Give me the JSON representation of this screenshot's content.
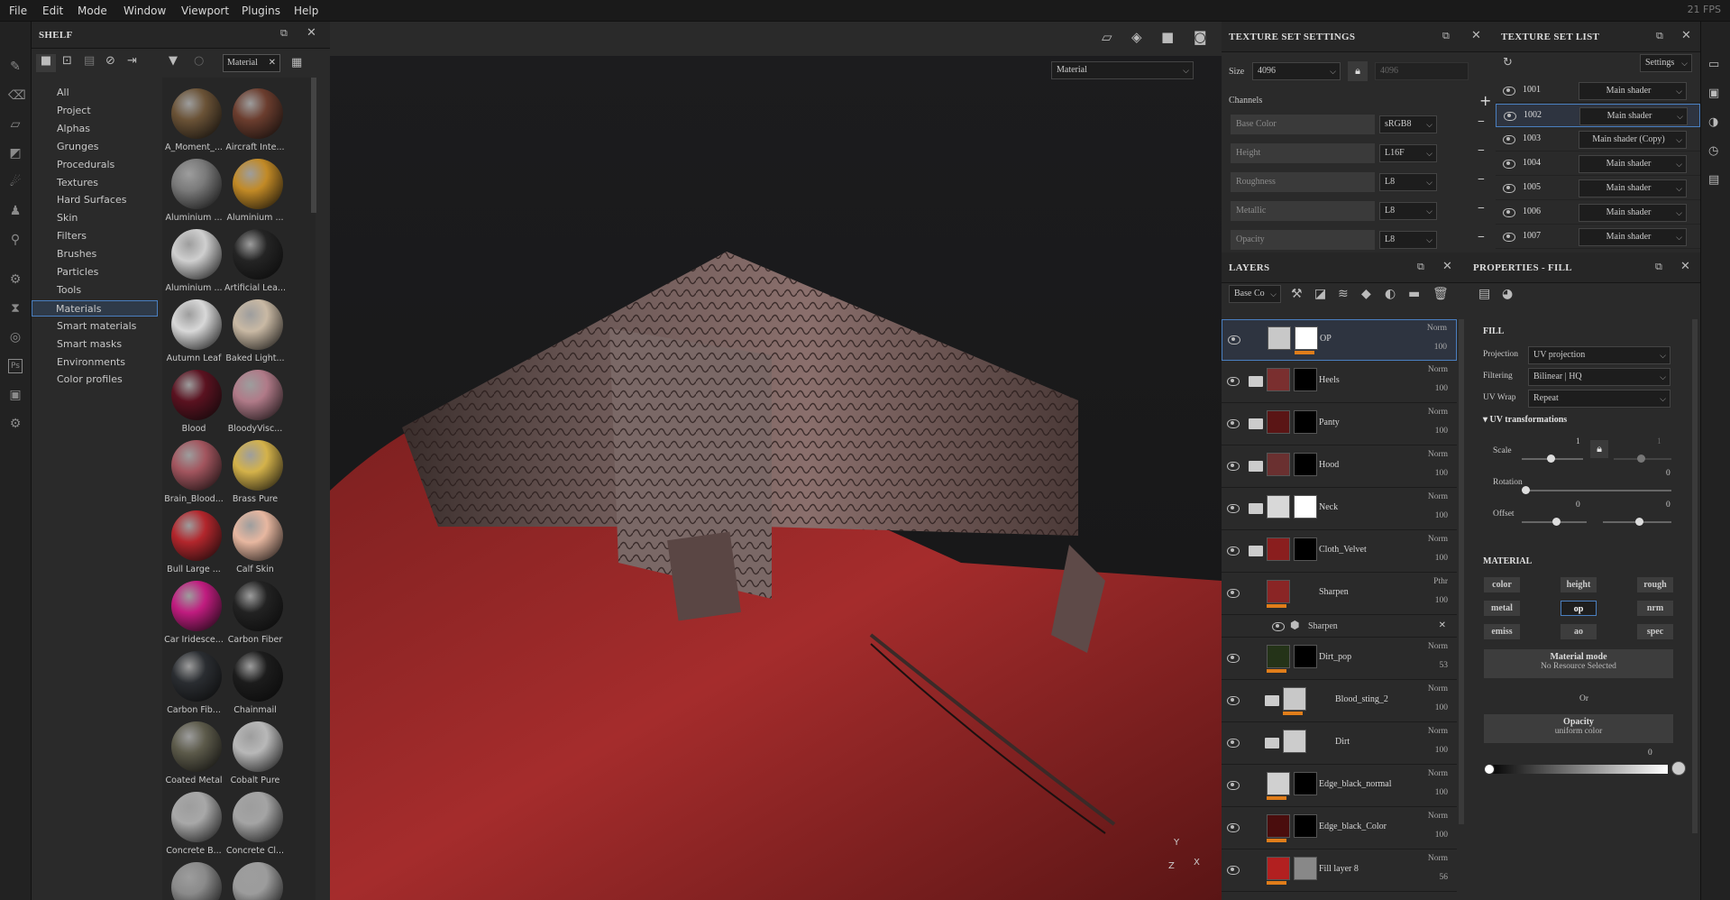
{
  "menu": [
    "File",
    "Edit",
    "Mode",
    "Window",
    "Viewport",
    "Plugins",
    "Help"
  ],
  "fps": "21 FPS",
  "shelf": {
    "title": "SHELF",
    "search_value": "Material",
    "categories": [
      "All",
      "Project",
      "Alphas",
      "Grunges",
      "Procedurals",
      "Textures",
      "Hard Surfaces",
      "Skin",
      "Filters",
      "Brushes",
      "Particles",
      "Tools",
      "Materials",
      "Smart materials",
      "Smart masks",
      "Environments",
      "Color profiles"
    ],
    "selected_category": "Materials",
    "materials": [
      {
        "label": "A_Moment_...",
        "color": "#6a5236"
      },
      {
        "label": "Aircraft Inte...",
        "color": "#6b3d2e"
      },
      {
        "label": "Aluminium ...",
        "color": "#7a7a7a"
      },
      {
        "label": "Aluminium ...",
        "color": "#c28a26"
      },
      {
        "label": "Aluminium ...",
        "color": "#cfcfcf"
      },
      {
        "label": "Artificial Lea...",
        "color": "#242424"
      },
      {
        "label": "Autumn Leaf",
        "color": "#d8d8d8"
      },
      {
        "label": "Baked Light...",
        "color": "#c9b9a4"
      },
      {
        "label": "Blood",
        "color": "#5a1220"
      },
      {
        "label": "BloodyVisc...",
        "color": "#b07a88"
      },
      {
        "label": "Brain_Blood...",
        "color": "#a2555e"
      },
      {
        "label": "Brass Pure",
        "color": "#d4b24a"
      },
      {
        "label": "Bull Large ...",
        "color": "#b2262c"
      },
      {
        "label": "Calf Skin",
        "color": "#e7b7a0"
      },
      {
        "label": "Car Iridesce...",
        "color": "#c01c7f"
      },
      {
        "label": "Carbon Fiber",
        "color": "#222222"
      },
      {
        "label": "Carbon Fib...",
        "color": "#2a2d31"
      },
      {
        "label": "Chainmail",
        "color": "#1c1c1c"
      },
      {
        "label": "Coated Metal",
        "color": "#5c5a4a"
      },
      {
        "label": "Cobalt Pure",
        "color": "#b8b8b8"
      },
      {
        "label": "Concrete B...",
        "color": "#a8a8a8"
      },
      {
        "label": "Concrete Cl...",
        "color": "#a4a4a4"
      },
      {
        "label": "",
        "color": "#8a8a8a"
      },
      {
        "label": "",
        "color": "#9c9c9c"
      }
    ]
  },
  "viewport": {
    "material_label": "Material",
    "axis_y": "Y",
    "axis_x": "X",
    "axis_z": "Z"
  },
  "texture_set_settings": {
    "title": "TEXTURE SET SETTINGS",
    "size_label": "Size",
    "size_value": "4096",
    "size_locked_value": "4096",
    "channels_label": "Channels",
    "channels": [
      {
        "name": "Base Color",
        "format": "sRGB8"
      },
      {
        "name": "Height",
        "format": "L16F"
      },
      {
        "name": "Roughness",
        "format": "L8"
      },
      {
        "name": "Metallic",
        "format": "L8"
      },
      {
        "name": "Opacity",
        "format": "L8"
      }
    ]
  },
  "texture_set_list": {
    "title": "TEXTURE SET LIST",
    "settings_label": "Settings",
    "items": [
      {
        "id": "1001",
        "shader": "Main shader"
      },
      {
        "id": "1002",
        "shader": "Main shader"
      },
      {
        "id": "1003",
        "shader": "Main shader (Copy)"
      },
      {
        "id": "1004",
        "shader": "Main shader"
      },
      {
        "id": "1005",
        "shader": "Main shader"
      },
      {
        "id": "1006",
        "shader": "Main shader"
      },
      {
        "id": "1007",
        "shader": "Main shader"
      }
    ]
  },
  "layers": {
    "title": "LAYERS",
    "channel_select": "Base Co",
    "items": [
      {
        "name": "OP",
        "mode": "Norm",
        "opacity": "100"
      },
      {
        "name": "Heels",
        "mode": "Norm",
        "opacity": "100"
      },
      {
        "name": "Panty",
        "mode": "Norm",
        "opacity": "100"
      },
      {
        "name": "Hood",
        "mode": "Norm",
        "opacity": "100"
      },
      {
        "name": "Neck",
        "mode": "Norm",
        "opacity": "100"
      },
      {
        "name": "Cloth_Velvet",
        "mode": "Norm",
        "opacity": "100"
      },
      {
        "name": "Sharpen",
        "mode": "Pthr",
        "opacity": "100"
      },
      {
        "name": "Dirt_pop",
        "mode": "Norm",
        "opacity": "53"
      },
      {
        "name": "Blood_sting_2",
        "mode": "Norm",
        "opacity": "100"
      },
      {
        "name": "Dirt",
        "mode": "Norm",
        "opacity": "100"
      },
      {
        "name": "Edge_black_normal",
        "mode": "Norm",
        "opacity": "100"
      },
      {
        "name": "Edge_black_Color",
        "mode": "Norm",
        "opacity": "100"
      },
      {
        "name": "Fill layer 8",
        "mode": "Norm",
        "opacity": "56"
      }
    ],
    "effect_name": "Sharpen"
  },
  "properties": {
    "title": "PROPERTIES - FILL",
    "fill_header": "FILL",
    "projection_label": "Projection",
    "projection_value": "UV projection",
    "filtering_label": "Filtering",
    "filtering_value": "Bilinear | HQ",
    "uvwrap_label": "UV Wrap",
    "uvwrap_value": "Repeat",
    "uvtrans_label": "UV transformations",
    "scale_label": "Scale",
    "scale_value": "1",
    "scale_value2": "1",
    "rotation_label": "Rotation",
    "rotation_value": "0",
    "offset_label": "Offset",
    "offset_value1": "0",
    "offset_value2": "0",
    "material_header": "MATERIAL",
    "chips": [
      "color",
      "height",
      "rough",
      "metal",
      "op",
      "nrm",
      "emiss",
      "ao",
      "spec"
    ],
    "material_mode": "Material mode",
    "no_resource": "No Resource Selected",
    "or_label": "Or",
    "opacity_label": "Opacity",
    "uniform_color": "uniform color",
    "opacity_value": "0"
  }
}
